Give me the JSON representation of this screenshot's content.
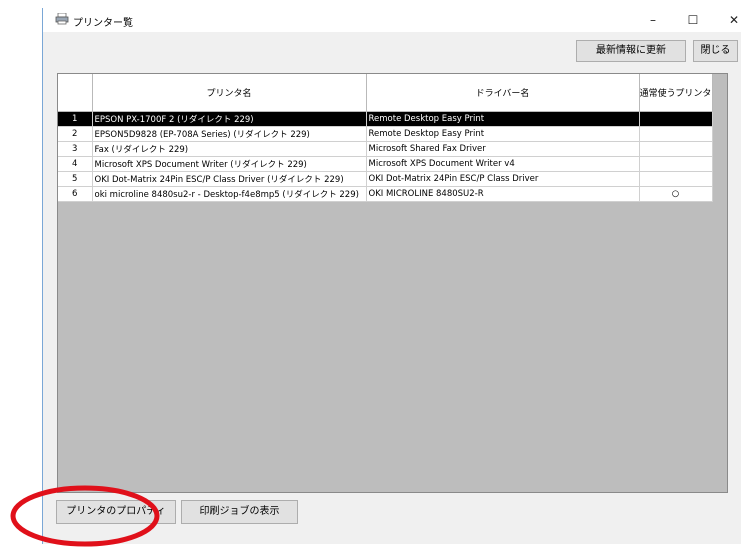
{
  "window": {
    "title": "プリンター覧",
    "controls": {
      "minimize": "–",
      "maximize": "☐",
      "close": "✕"
    }
  },
  "toolbar": {
    "refresh_label": "最新情報に更新",
    "close_label": "閉じる"
  },
  "table": {
    "columns": [
      "",
      "プリンタ名",
      "ドライバー名",
      "通常使うプリンタ"
    ],
    "rows": [
      {
        "no": "1",
        "printer": "EPSON PX-1700F 2 (リダイレクト 229)",
        "driver": "Remote Desktop Easy Print",
        "default": "",
        "selected": true
      },
      {
        "no": "2",
        "printer": "EPSON5D9828 (EP-708A Series) (リダイレクト 229)",
        "driver": "Remote Desktop Easy Print",
        "default": ""
      },
      {
        "no": "3",
        "printer": "Fax (リダイレクト 229)",
        "driver": "Microsoft Shared Fax Driver",
        "default": ""
      },
      {
        "no": "4",
        "printer": "Microsoft XPS Document Writer (リダイレクト 229)",
        "driver": "Microsoft XPS Document Writer v4",
        "default": ""
      },
      {
        "no": "5",
        "printer": "OKI Dot-Matrix 24Pin ESC/P Class Driver (リダイレクト 229)",
        "driver": "OKI Dot-Matrix 24Pin ESC/P Class Driver",
        "default": ""
      },
      {
        "no": "6",
        "printer": "oki microline 8480su2-r - Desktop-f4e8mp5 (リダイレクト 229)",
        "driver": "OKI MICROLINE 8480SU2-R",
        "default": "○"
      }
    ]
  },
  "footer": {
    "properties_label": "プリンタのプロパティ",
    "jobs_label": "印刷ジョブの表示"
  },
  "colors": {
    "highlight_ellipse": "#e0101a",
    "selected_row": "#000000"
  }
}
